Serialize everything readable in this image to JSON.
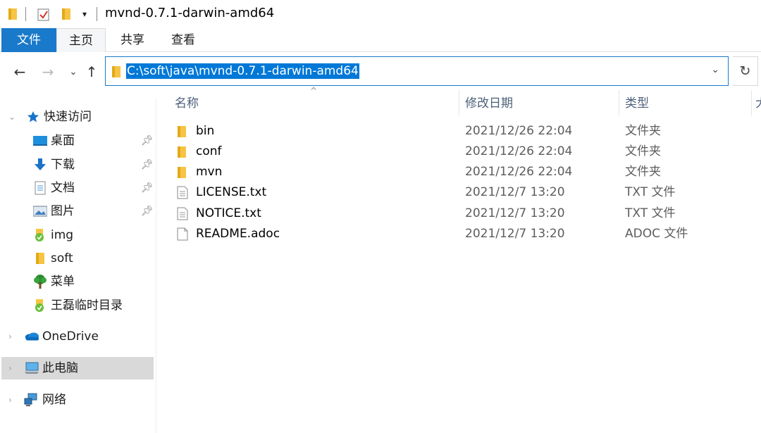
{
  "window": {
    "title": "mvnd-0.7.1-darwin-amd64"
  },
  "ribbon": {
    "tabs": [
      {
        "label": "文件"
      },
      {
        "label": "主页"
      },
      {
        "label": "共享"
      },
      {
        "label": "查看"
      }
    ]
  },
  "address": {
    "path": "C:\\soft\\java\\mvnd-0.7.1-darwin-amd64"
  },
  "icons": {
    "back": "arrow-left-icon",
    "forward": "arrow-right-icon",
    "recent": "chevron-down-icon",
    "up": "arrow-up-icon",
    "refresh": "refresh-icon"
  },
  "sidebar": {
    "quick_access": "快速访问",
    "items": [
      {
        "label": "桌面",
        "icon": "desktop-icon",
        "pinned": true
      },
      {
        "label": "下载",
        "icon": "download-icon",
        "pinned": true
      },
      {
        "label": "文档",
        "icon": "document-icon",
        "pinned": true
      },
      {
        "label": "图片",
        "icon": "pictures-icon",
        "pinned": true
      },
      {
        "label": "img",
        "icon": "green-folder-icon",
        "pinned": false
      },
      {
        "label": "soft",
        "icon": "folder-icon",
        "pinned": false
      },
      {
        "label": "菜单",
        "icon": "tree-icon",
        "pinned": false
      },
      {
        "label": "王磊临时目录",
        "icon": "green-folder-icon",
        "pinned": false
      }
    ],
    "onedrive": "OneDrive",
    "this_pc": "此电脑",
    "network": "网络"
  },
  "columns": {
    "name": "名称",
    "date": "修改日期",
    "type": "类型",
    "extra": "大"
  },
  "files": [
    {
      "name": "bin",
      "date": "2021/12/26 22:04",
      "type": "文件夹",
      "kind": "folder"
    },
    {
      "name": "conf",
      "date": "2021/12/26 22:04",
      "type": "文件夹",
      "kind": "folder"
    },
    {
      "name": "mvn",
      "date": "2021/12/26 22:04",
      "type": "文件夹",
      "kind": "folder"
    },
    {
      "name": "LICENSE.txt",
      "date": "2021/12/7 13:20",
      "type": "TXT 文件",
      "kind": "txt"
    },
    {
      "name": "NOTICE.txt",
      "date": "2021/12/7 13:20",
      "type": "TXT 文件",
      "kind": "txt"
    },
    {
      "name": "README.adoc",
      "date": "2021/12/7 13:20",
      "type": "ADOC 文件",
      "kind": "file"
    }
  ],
  "colors": {
    "accent": "#1979ca",
    "selection": "#0078d7",
    "folder": "#f6c445",
    "sidebar_selected": "#d9d9d9"
  }
}
